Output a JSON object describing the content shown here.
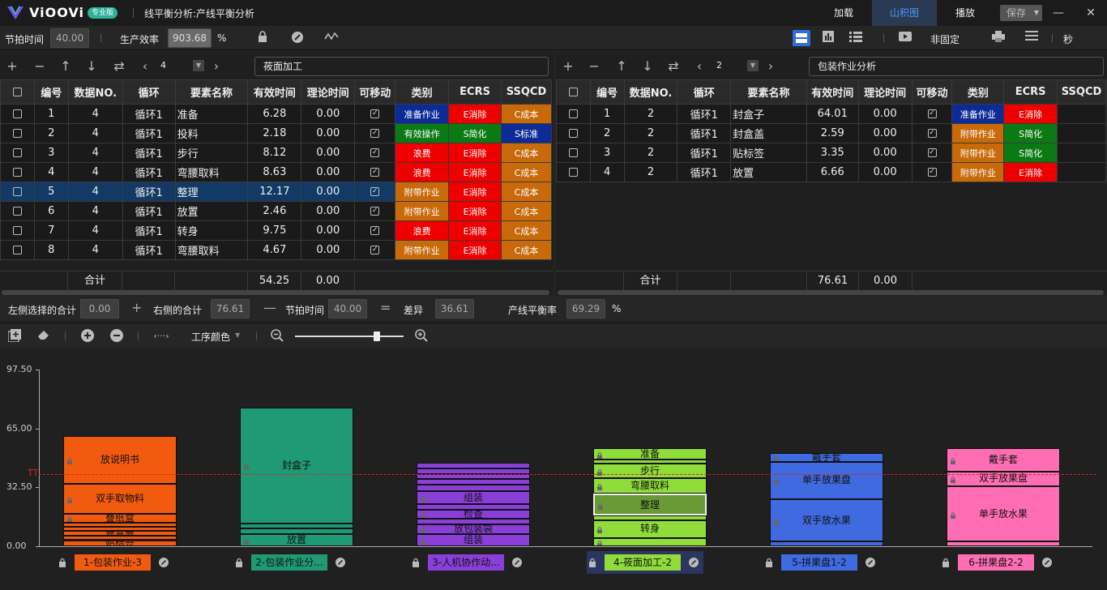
{
  "app": {
    "name": "ViOOVi",
    "badge": "专业版",
    "window_title": "线平衡分析:产线平衡分析"
  },
  "tabs": [
    {
      "label": "加载"
    },
    {
      "label": "山积图"
    },
    {
      "label": "播放"
    }
  ],
  "save_label": "保存",
  "toolbar": {
    "cycle_label": "节拍时间",
    "cycle_value": "40.00",
    "eff_label": "生产效率",
    "eff_value": "903.68",
    "eff_unit": "%",
    "fixed_label": "非固定",
    "unit_label": "秒"
  },
  "left": {
    "page": "4",
    "name": "莜面加工",
    "headers": [
      "编号",
      "数据NO.",
      "循环",
      "要素名称",
      "有效时间",
      "理论时间",
      "可移动",
      "类别",
      "ECRS",
      "SSQCD"
    ],
    "rows": [
      {
        "id": "1",
        "no": "4",
        "loop": "循环1",
        "name": "准备",
        "eff": "6.28",
        "theo": "0.00",
        "cat": "准备作业",
        "catc": "c-prep",
        "ecrs": "E消除",
        "ecrsc": "c-e",
        "ssqcd": "C成本",
        "ssqcdc": "c-c"
      },
      {
        "id": "2",
        "no": "4",
        "loop": "循环1",
        "name": "投料",
        "eff": "2.18",
        "theo": "0.00",
        "cat": "有效操作",
        "catc": "c-eff",
        "ecrs": "S简化",
        "ecrsc": "c-s",
        "ssqcd": "S标准",
        "ssqcdc": "c-std"
      },
      {
        "id": "3",
        "no": "4",
        "loop": "循环1",
        "name": "步行",
        "eff": "8.12",
        "theo": "0.00",
        "cat": "浪费",
        "catc": "c-waste",
        "ecrs": "E消除",
        "ecrsc": "c-e",
        "ssqcd": "C成本",
        "ssqcdc": "c-c"
      },
      {
        "id": "4",
        "no": "4",
        "loop": "循环1",
        "name": "弯腰取料",
        "eff": "8.63",
        "theo": "0.00",
        "cat": "浪费",
        "catc": "c-waste",
        "ecrs": "E消除",
        "ecrsc": "c-e",
        "ssqcd": "C成本",
        "ssqcdc": "c-c"
      },
      {
        "id": "5",
        "no": "4",
        "loop": "循环1",
        "name": "整理",
        "eff": "12.17",
        "theo": "0.00",
        "cat": "附带作业",
        "catc": "c-aux",
        "ecrs": "E消除",
        "ecrsc": "c-e",
        "ssqcd": "C成本",
        "ssqcdc": "c-c",
        "sel": true
      },
      {
        "id": "6",
        "no": "4",
        "loop": "循环1",
        "name": "放置",
        "eff": "2.46",
        "theo": "0.00",
        "cat": "附带作业",
        "catc": "c-aux",
        "ecrs": "E消除",
        "ecrsc": "c-e",
        "ssqcd": "C成本",
        "ssqcdc": "c-c"
      },
      {
        "id": "7",
        "no": "4",
        "loop": "循环1",
        "name": "转身",
        "eff": "9.75",
        "theo": "0.00",
        "cat": "浪费",
        "catc": "c-waste",
        "ecrs": "E消除",
        "ecrsc": "c-e",
        "ssqcd": "C成本",
        "ssqcdc": "c-c"
      },
      {
        "id": "8",
        "no": "4",
        "loop": "循环1",
        "name": "弯腰取料",
        "eff": "4.67",
        "theo": "0.00",
        "cat": "附带作业",
        "catc": "c-aux",
        "ecrs": "E消除",
        "ecrsc": "c-e",
        "ssqcd": "C成本",
        "ssqcdc": "c-c"
      }
    ],
    "sum_label": "合计",
    "sum_eff": "54.25",
    "sum_theo": "0.00"
  },
  "right": {
    "page": "2",
    "name": "包装作业分析",
    "headers": [
      "编号",
      "数据NO.",
      "循环",
      "要素名称",
      "有效时间",
      "理论时间",
      "可移动",
      "类别",
      "ECRS",
      "SSQCD"
    ],
    "rows": [
      {
        "id": "1",
        "no": "2",
        "loop": "循环1",
        "name": "封盒子",
        "eff": "64.01",
        "theo": "0.00",
        "cat": "准备作业",
        "catc": "c-prep",
        "ecrs": "E消除",
        "ecrsc": "c-e"
      },
      {
        "id": "2",
        "no": "2",
        "loop": "循环1",
        "name": "封盒盖",
        "eff": "2.59",
        "theo": "0.00",
        "cat": "附带作业",
        "catc": "c-aux",
        "ecrs": "S简化",
        "ecrsc": "c-s"
      },
      {
        "id": "3",
        "no": "2",
        "loop": "循环1",
        "name": "贴标签",
        "eff": "3.35",
        "theo": "0.00",
        "cat": "附带作业",
        "catc": "c-aux",
        "ecrs": "S简化",
        "ecrsc": "c-s"
      },
      {
        "id": "4",
        "no": "2",
        "loop": "循环1",
        "name": "放置",
        "eff": "6.66",
        "theo": "0.00",
        "cat": "附带作业",
        "catc": "c-aux",
        "ecrs": "E消除",
        "ecrsc": "c-e"
      }
    ],
    "sum_label": "合计",
    "sum_eff": "76.61",
    "sum_theo": "0.00"
  },
  "summary": {
    "left_label": "左侧选择的合计",
    "left_value": "0.00",
    "right_label": "右侧的合计",
    "right_value": "76.61",
    "cycle_label": "节拍时间",
    "cycle_value": "40.00",
    "diff_label": "差异",
    "diff_value": "36.61",
    "bal_label": "产线平衡率",
    "bal_value": "69.29",
    "bal_unit": "%"
  },
  "bottom_toolbar": {
    "color_label": "工序颜色"
  },
  "chart_data": {
    "type": "bar",
    "stacked": true,
    "ylim": [
      0,
      97.5
    ],
    "y_ticks": [
      "97.50",
      "65.00",
      "32.50",
      "0.00"
    ],
    "tt_label": "TT",
    "tt_value": 40,
    "stations": [
      {
        "label": "1-包装作业-3",
        "color": "#f25a0f",
        "elements": [
          {
            "name": "贴标签",
            "v": 3.35
          },
          {
            "name": "",
            "v": 2.5
          },
          {
            "name": "盖盒盖",
            "v": 2.59
          },
          {
            "name": "",
            "v": 2.2
          },
          {
            "name": "",
            "v": 2.2
          },
          {
            "name": "叠纸盒",
            "v": 5.2
          },
          {
            "name": "双手取物料",
            "v": 16.5
          },
          {
            "name": "放说明书",
            "v": 26.5
          }
        ]
      },
      {
        "label": "2-包装作业分...",
        "color": "#1f9a74",
        "elements": [
          {
            "name": "放置",
            "v": 6.66
          },
          {
            "name": "",
            "v": 3.35
          },
          {
            "name": "",
            "v": 2.59
          },
          {
            "name": "封盒子",
            "v": 64.01
          }
        ]
      },
      {
        "label": "3-人机协作动...",
        "color": "#8a3fd8",
        "elements": [
          {
            "name": "组装",
            "v": 6.8
          },
          {
            "name": "放包装袋",
            "v": 5.3
          },
          {
            "name": "",
            "v": 3.0
          },
          {
            "name": "检查",
            "v": 5.2
          },
          {
            "name": "",
            "v": 3.0
          },
          {
            "name": "组装",
            "v": 7.3
          },
          {
            "name": "",
            "v": 3.2
          },
          {
            "name": "",
            "v": 3.2
          },
          {
            "name": "",
            "v": 3.0
          },
          {
            "name": "",
            "v": 3.0
          },
          {
            "name": "",
            "v": 3.0
          }
        ]
      },
      {
        "label": "4-莜面加工-2",
        "color": "#8fdc3a",
        "elements": [
          {
            "name": "",
            "v": 4.67
          },
          {
            "name": "转身",
            "v": 9.75
          },
          {
            "name": "",
            "v": 2.46
          },
          {
            "name": "整理",
            "v": 12.17
          },
          {
            "name": "弯腰取料",
            "v": 8.63
          },
          {
            "name": "步行",
            "v": 8.12
          },
          {
            "name": "",
            "v": 2.18
          },
          {
            "name": "准备",
            "v": 6.28
          }
        ]
      },
      {
        "label": "5-拼果盘1-2",
        "color": "#3f6ae0",
        "elements": [
          {
            "name": "",
            "v": 2.5
          },
          {
            "name": "双手放水果",
            "v": 23.5
          },
          {
            "name": "单手放果盘",
            "v": 20.5
          },
          {
            "name": "戴手套",
            "v": 5.0
          }
        ]
      },
      {
        "label": "6-拼果盘2-2",
        "color": "#ff6eb4",
        "elements": [
          {
            "name": "",
            "v": 2.5
          },
          {
            "name": "单手放水果",
            "v": 30.5
          },
          {
            "name": "双手放果盘",
            "v": 8.0
          },
          {
            "name": "戴手套",
            "v": 13.0
          }
        ]
      }
    ]
  }
}
